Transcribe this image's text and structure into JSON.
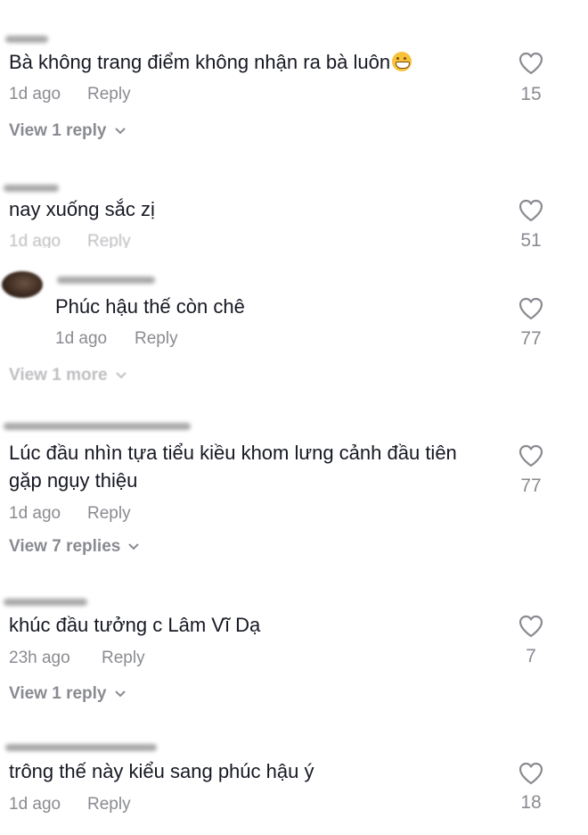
{
  "comments": [
    {
      "text": "Bà không trang điểm không nhận ra bà luôn",
      "emoji": "grin",
      "time": "1d ago",
      "reply": "Reply",
      "view": "View 1 reply",
      "likes": "15"
    },
    {
      "text": "nay xuống sắc zị",
      "time": "1d ago",
      "reply": "Reply",
      "likes": "51"
    },
    {
      "text": "Phúc hậu thế còn chê",
      "time": "1d ago",
      "reply": "Reply",
      "view": "View 1 more",
      "likes": "77"
    },
    {
      "text_line1": "Lúc đầu nhìn tựa tiểu kiều khom lưng cảnh đầu tiên",
      "text_line2": "gặp ngụy thiệu",
      "time": "1d ago",
      "reply": "Reply",
      "view": "View 7 replies",
      "likes": "77"
    },
    {
      "text": "khúc đầu tưởng c Lâm Vĩ Dạ",
      "time": "23h ago",
      "reply": "Reply",
      "view": "View 1 reply",
      "likes": "7"
    },
    {
      "text": "trông thế này kiểu sang phúc hậu ý",
      "time": "1d ago",
      "reply": "Reply",
      "likes": "18"
    }
  ],
  "icons": {
    "like": "heart-outline-icon",
    "expand": "chevron-down-icon"
  },
  "colors": {
    "text": "#161823",
    "muted": "#8a8b91",
    "background": "#ffffff"
  }
}
